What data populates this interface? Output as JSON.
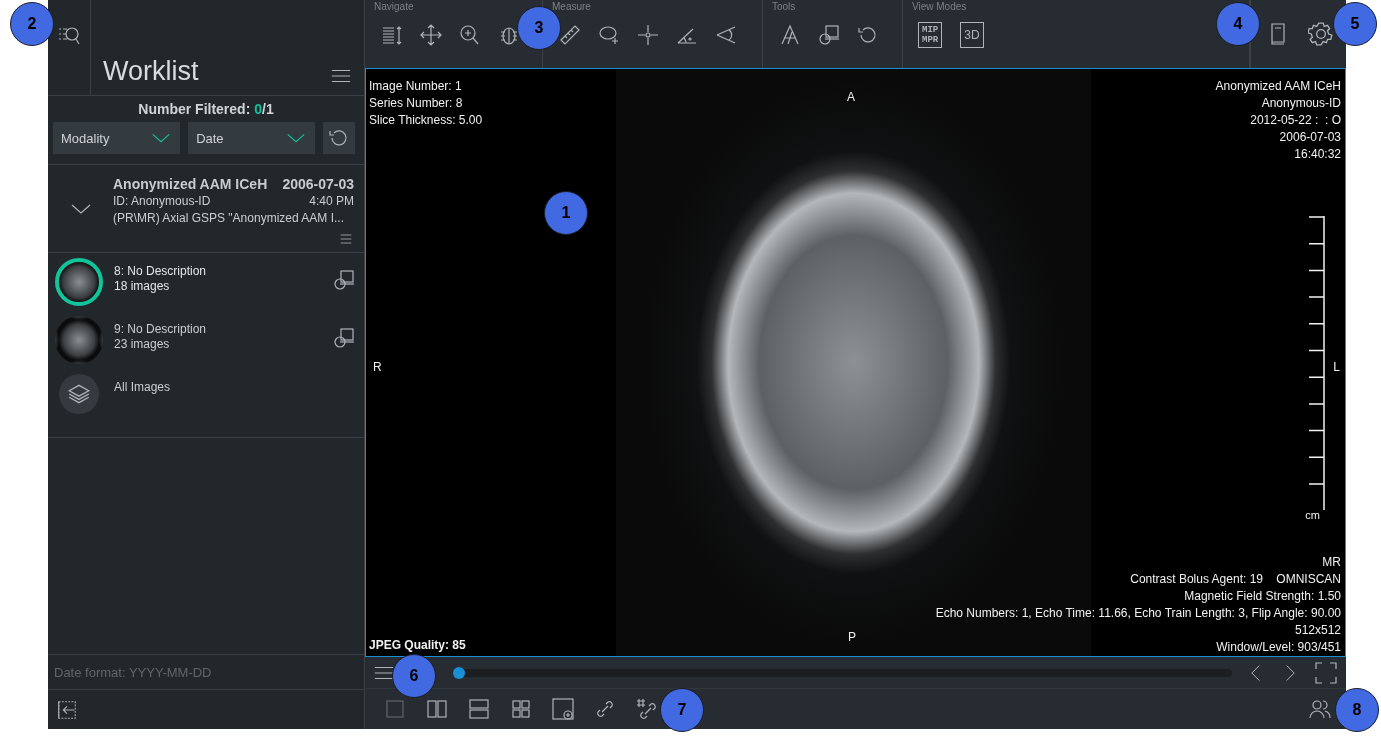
{
  "sidebar": {
    "title": "Worklist",
    "filter_count": {
      "label": "Number Filtered: ",
      "filtered": "0",
      "total": "/1"
    },
    "dropdowns": [
      "Modality",
      "Date"
    ],
    "study": {
      "name": "Anonymized AAM ICeH",
      "date": "2006-07-03",
      "id": "ID: Anonymous-ID",
      "time": "4:40 PM",
      "description": "(PR\\MR) Axial GSPS \"Anonymized AAM I...",
      "expanded": true
    },
    "series": [
      {
        "kind": "series",
        "title": "8: No Description",
        "count": "18 images",
        "selected": true
      },
      {
        "kind": "series",
        "title": "9: No Description",
        "count": "23 images",
        "selected": false
      },
      {
        "kind": "all",
        "title": "All Images",
        "selected": false
      }
    ],
    "date_format": "Date format: YYYY-MM-DD"
  },
  "toolbar": {
    "groups": [
      {
        "label": "Navigate"
      },
      {
        "label": "Measure"
      },
      {
        "label": "Tools"
      },
      {
        "label": "View Modes",
        "buttons": [
          [
            "MIP",
            "MPR"
          ],
          [
            "3D"
          ]
        ]
      }
    ]
  },
  "viewport": {
    "top_left": [
      "Image Number: 1",
      "Series Number: 8",
      "Slice Thickness: 5.00"
    ],
    "top_right": [
      "Anonymized AAM ICeH",
      "Anonymous-ID",
      "2012-05-22 :  : O",
      "2006-07-03",
      "16:40:32"
    ],
    "bottom_right": [
      "MR",
      "Contrast Bolus Agent: 19    OMNISCAN",
      "Magnetic Field Strength: 1.50",
      "Echo Numbers: 1, Echo Time: 11.66, Echo Train Length: 3, Flip Angle: 90.00",
      "512x512",
      "Window/Level: 903/451"
    ],
    "bottom_left": "JPEG Quality: 85",
    "orientation": {
      "top": "A",
      "left": "R",
      "right": "L",
      "bottom": "P"
    },
    "scale_unit": "cm"
  },
  "slider": {
    "level": 0
  },
  "callouts": [
    "1",
    "2",
    "3",
    "4",
    "5",
    "6",
    "7",
    "8"
  ]
}
